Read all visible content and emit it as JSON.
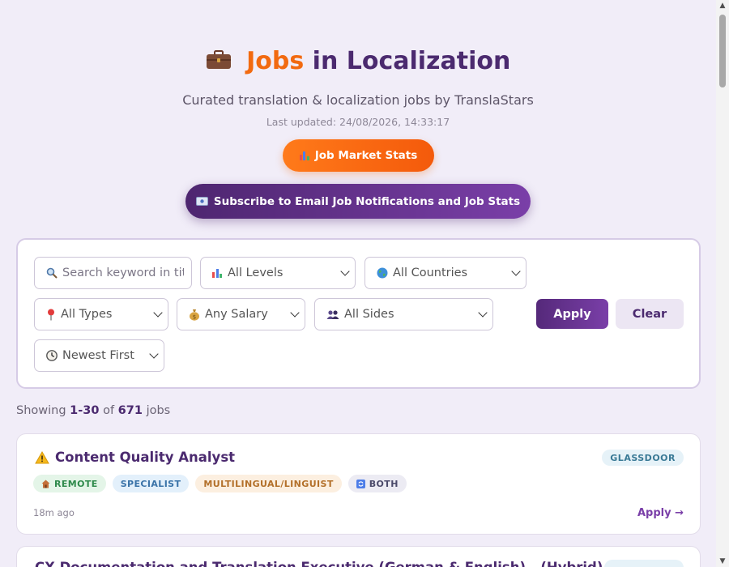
{
  "header": {
    "title_icon": "briefcase-icon",
    "title_accent": "Jobs",
    "title_rest": "in Localization",
    "subtitle": "Curated translation & localization jobs by TranslaStars",
    "last_updated": "Last updated: 24/08/2026, 14:33:17",
    "stats_button": "Job Market Stats",
    "subscribe_button": "Subscribe to Email Job Notifications and Job Stats"
  },
  "filters": {
    "search_placeholder": "Search keyword in title",
    "level": "All Levels",
    "country": "All Countries",
    "type": "All Types",
    "salary": "Any Salary",
    "side": "All Sides",
    "sort": "Newest First",
    "apply_label": "Apply",
    "clear_label": "Clear"
  },
  "results": {
    "prefix": "Showing",
    "range": "1-30",
    "of": "of",
    "total": "671",
    "suffix": "jobs"
  },
  "jobs": [
    {
      "title": "Content Quality Analyst",
      "source": "GLASSDOOR",
      "tags": [
        "REMOTE",
        "SPECIALIST",
        "MULTILINGUAL/LINGUIST",
        "BOTH"
      ],
      "posted": "18m ago",
      "apply_label": "Apply →"
    },
    {
      "title": "CX Documentation and Translation Executive (German & English) - (Hybrid)"
    }
  ],
  "colors": {
    "accent_orange": "#f26a10",
    "brand_purple": "#4b2a6f",
    "background": "#f1edf8"
  }
}
